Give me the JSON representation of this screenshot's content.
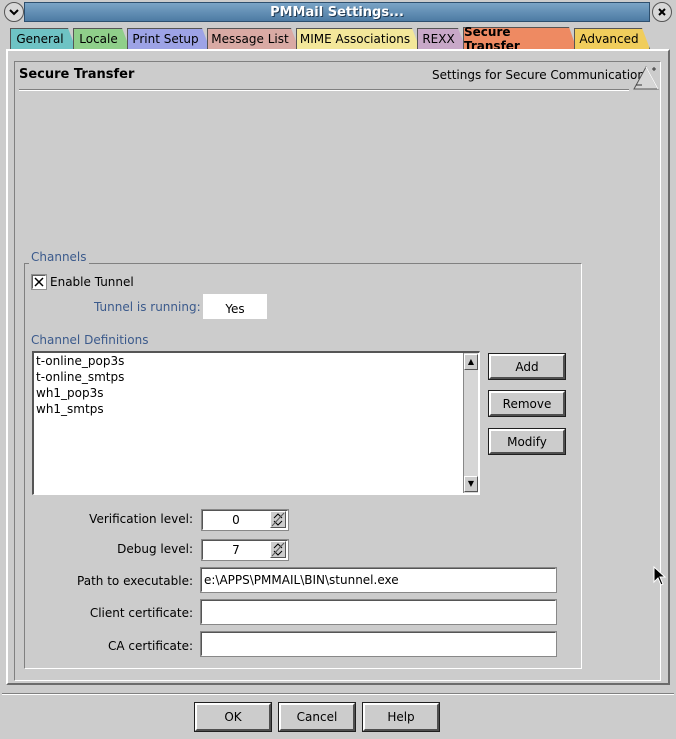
{
  "window": {
    "title": "PMMail Settings...",
    "system_menu_icon": "chevron-down-icon",
    "close_icon": "close-icon"
  },
  "tabs": [
    {
      "label": "General",
      "color": "#6ec3c4"
    },
    {
      "label": "Locale",
      "color": "#8fcf8a"
    },
    {
      "label": "Print Setup",
      "color": "#9da3e6"
    },
    {
      "label": "Message List",
      "color": "#d9aaa4"
    },
    {
      "label": "MIME Associations",
      "color": "#f3e79a"
    },
    {
      "label": "REXX",
      "color": "#c8a8c8"
    },
    {
      "label": "Secure Transfer",
      "color": "#ee8a62",
      "active": true
    },
    {
      "label": "Advanced",
      "color": "#f0cd5c"
    }
  ],
  "page": {
    "title": "Secure Transfer",
    "subtitle": "Settings for Secure Communication"
  },
  "channels": {
    "group_label": "Channels",
    "enable_tunnel_label": "Enable Tunnel",
    "enable_tunnel_checked": true,
    "tunnel_running_label": "Tunnel is running:",
    "tunnel_running_value": "Yes",
    "definitions_label": "Channel Definitions",
    "definitions": [
      "t-online_pop3s",
      "t-online_smtps",
      "wh1_pop3s",
      "wh1_smtps"
    ],
    "add_label": "Add",
    "remove_label": "Remove",
    "modify_label": "Modify",
    "verification_label": "Verification level:",
    "verification_value": "0",
    "debug_label": "Debug level:",
    "debug_value": "7",
    "path_label": "Path to executable:",
    "path_value": "e:\\APPS\\PMMAIL\\BIN\\stunnel.exe",
    "client_cert_label": "Client certificate:",
    "client_cert_value": "",
    "ca_cert_label": "CA certificate:",
    "ca_cert_value": ""
  },
  "footer": {
    "ok_label": "OK",
    "cancel_label": "Cancel",
    "help_label": "Help"
  },
  "colors": {
    "title_bar": "#4d7ba3",
    "label_blue": "#3b5a8c",
    "background": "#cccccc"
  }
}
